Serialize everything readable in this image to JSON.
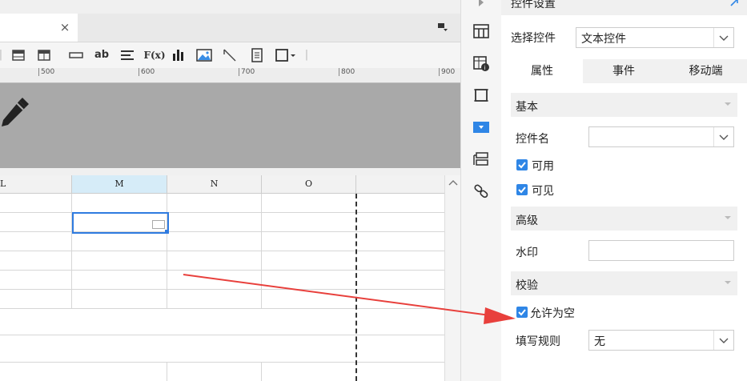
{
  "editor": {
    "tab_close": "×",
    "toolbar": {
      "text_button": "ab",
      "formula_button": "F(x)"
    },
    "ruler_labels": [
      "500",
      "600",
      "700",
      "800",
      "900"
    ],
    "columns": [
      "L",
      "M",
      "N",
      "O"
    ]
  },
  "panel": {
    "title": "控件设置",
    "select_control_label": "选择控件",
    "select_control_value": "文本控件",
    "tabs": [
      "属性",
      "事件",
      "移动端"
    ],
    "basic_section": "基本",
    "control_name_label": "控件名",
    "control_name_value": "",
    "enabled_label": "可用",
    "visible_label": "可见",
    "advanced_section": "高级",
    "watermark_label": "水印",
    "watermark_value": "",
    "validation_section": "校验",
    "allow_empty_label": "允许为空",
    "fill_rule_label": "填写规则",
    "fill_rule_value": "无"
  },
  "colors": {
    "accent": "#2f86e6",
    "selection": "#2f7be0",
    "arrow": "#e8403c",
    "active_column_header": "#d6ecf8"
  },
  "checkbox_states": {
    "enabled": true,
    "visible": true,
    "allow_empty": true
  }
}
